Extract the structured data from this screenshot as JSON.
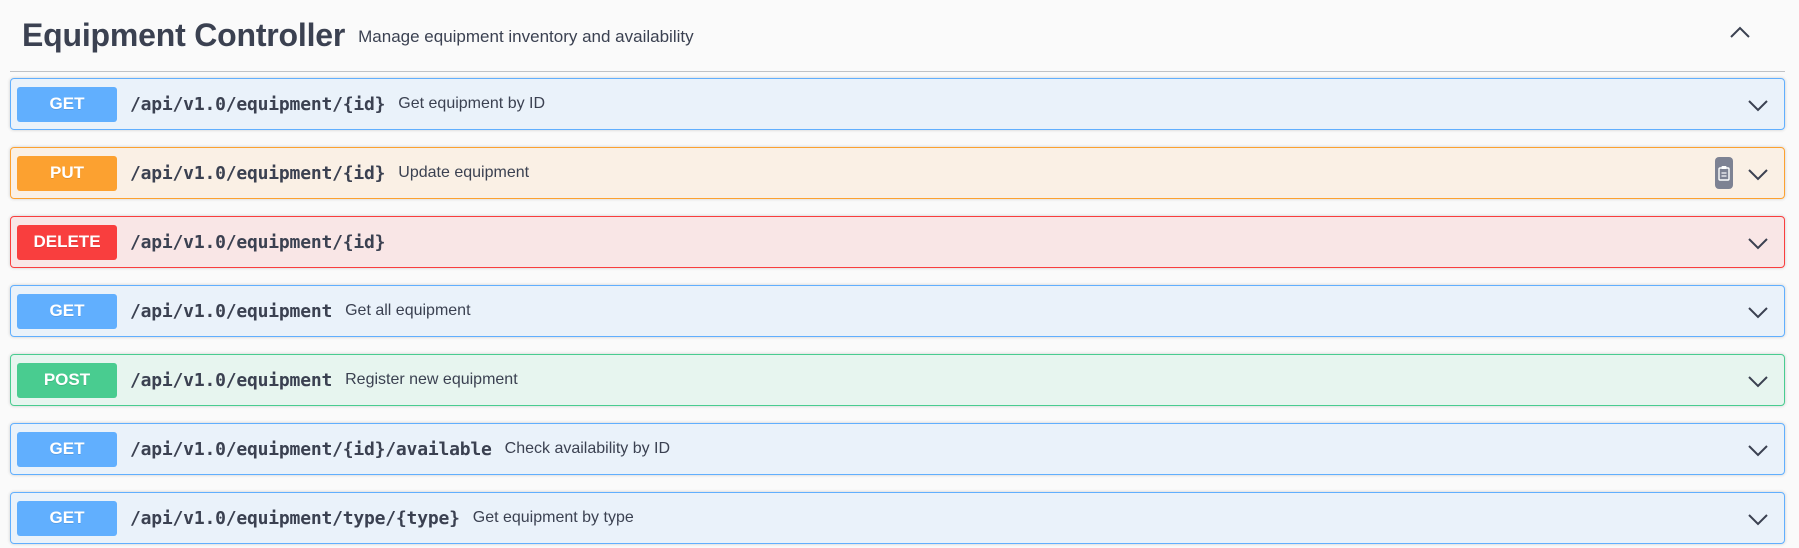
{
  "section": {
    "title": "Equipment Controller",
    "description": "Manage equipment inventory and availability",
    "collapse_icon": "chevron-up-icon"
  },
  "operations": [
    {
      "method": "GET",
      "path": "/api/v1.0/equipment/{id}",
      "summary": "Get equipment by ID",
      "color": "#61affe"
    },
    {
      "method": "PUT",
      "path": "/api/v1.0/equipment/{id}",
      "summary": "Update equipment",
      "color": "#fca130",
      "copy_icon": "clipboard-icon"
    },
    {
      "method": "DELETE",
      "path": "/api/v1.0/equipment/{id}",
      "summary": "",
      "color": "#f93e3e"
    },
    {
      "method": "GET",
      "path": "/api/v1.0/equipment",
      "summary": "Get all equipment",
      "color": "#61affe"
    },
    {
      "method": "POST",
      "path": "/api/v1.0/equipment",
      "summary": "Register new equipment",
      "color": "#49cc90"
    },
    {
      "method": "GET",
      "path": "/api/v1.0/equipment/{id}/available",
      "summary": "Check availability by ID",
      "color": "#61affe"
    },
    {
      "method": "GET",
      "path": "/api/v1.0/equipment/type/{type}",
      "summary": "Get equipment by type",
      "color": "#61affe"
    }
  ]
}
